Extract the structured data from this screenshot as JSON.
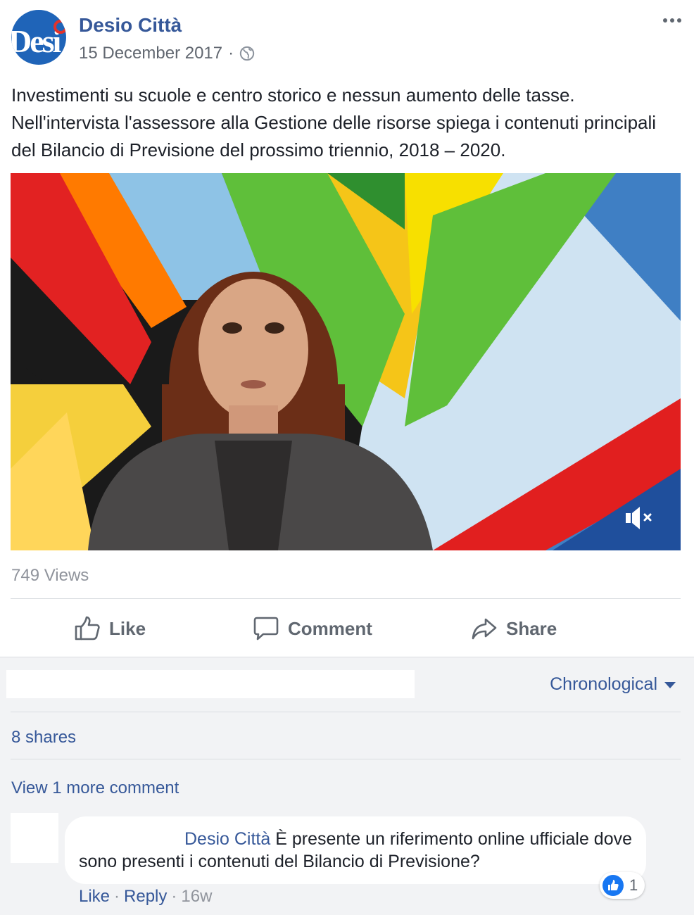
{
  "post": {
    "page_name": "Desio Città",
    "date": "15 December 2017",
    "separator": "·",
    "text": "Investimenti su scuole e centro storico e nessun aumento delle tasse. Nell'intervista l'assessore alla Gestione delle risorse spiega i contenuti principali del Bilancio di Previsione del prossimo triennio, 2018 – 2020.",
    "avatar_text": "Desi",
    "views": "749 Views"
  },
  "actions": {
    "like": "Like",
    "comment": "Comment",
    "share": "Share"
  },
  "comments_section": {
    "sort_label": "Chronological",
    "shares": "8 shares",
    "view_more": "View 1 more comment",
    "comment": {
      "mention": "Desio Città",
      "text": "È presente un riferimento online ufficiale dove sono presenti i contenuti del Bilancio di Previsione?",
      "reaction_count": "1",
      "like": "Like",
      "reply": "Reply",
      "time": "16w",
      "separator": "·"
    }
  },
  "colors": {
    "link": "#365899",
    "muted": "#90949c",
    "background": "#f2f3f5",
    "reaction_blue": "#1877f2"
  },
  "icons": {
    "globe": "globe-icon",
    "more": "more-options-icon",
    "like": "thumbs-up-icon",
    "comment": "speech-bubble-icon",
    "share": "share-arrow-icon",
    "mute": "volume-muted-icon"
  }
}
